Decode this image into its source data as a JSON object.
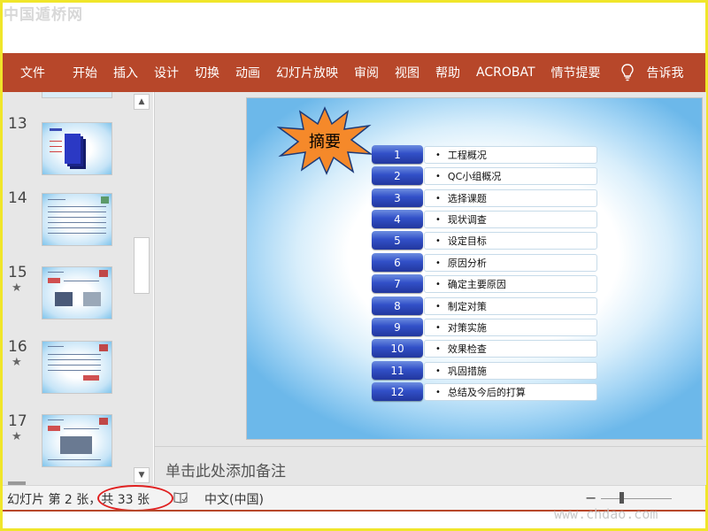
{
  "watermark_top": "中国遁桥网",
  "watermark_bottom": "www.chdao.com",
  "ribbon": {
    "tabs": [
      "文件",
      "开始",
      "插入",
      "设计",
      "切换",
      "动画",
      "幻灯片放映",
      "审阅",
      "视图",
      "帮助",
      "ACROBAT",
      "情节提要"
    ],
    "tell_me": "告诉我",
    "tell_icon": "lightbulb-icon"
  },
  "thumbnails": [
    {
      "num": "13",
      "star": ""
    },
    {
      "num": "14",
      "star": ""
    },
    {
      "num": "15",
      "star": "★"
    },
    {
      "num": "16",
      "star": "★"
    },
    {
      "num": "17",
      "star": "★"
    }
  ],
  "slide": {
    "title_burst": "摘要",
    "items": [
      {
        "num": "1",
        "label": "工程概况"
      },
      {
        "num": "2",
        "label": "QC小组概况"
      },
      {
        "num": "3",
        "label": "选择课题"
      },
      {
        "num": "4",
        "label": "现状调查"
      },
      {
        "num": "5",
        "label": "设定目标"
      },
      {
        "num": "6",
        "label": "原因分析"
      },
      {
        "num": "7",
        "label": "确定主要原因"
      },
      {
        "num": "8",
        "label": "制定对策"
      },
      {
        "num": "9",
        "label": "对策实施"
      },
      {
        "num": "10",
        "label": "效果检查"
      },
      {
        "num": "11",
        "label": "巩固措施"
      },
      {
        "num": "12",
        "label": "总结及今后的打算"
      }
    ],
    "bullet": "•"
  },
  "notes_placeholder": "单击此处添加备注",
  "status": {
    "slide_info": "幻灯片 第 2 张，共 33 张",
    "language": "中文(中国)",
    "zoom_minus": "−"
  },
  "colors": {
    "ribbon": "#b7472a",
    "highlight": "#e02020",
    "frame": "#f0e62a",
    "num_box": "#3250c8"
  }
}
